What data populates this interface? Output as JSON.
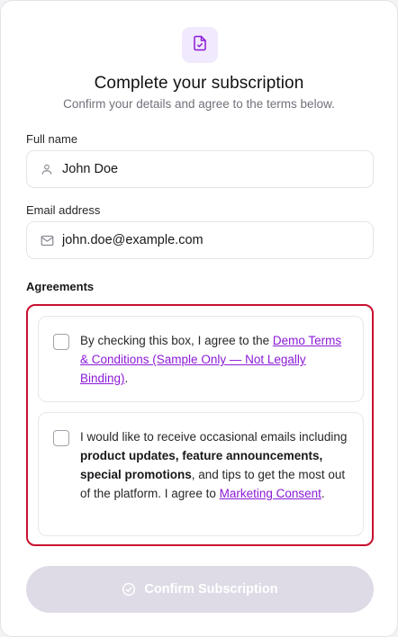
{
  "header": {
    "logo_icon": "file-check-icon",
    "title": "Complete your subscription",
    "subtitle": "Confirm your details and agree to the terms below."
  },
  "form": {
    "full_name": {
      "label": "Full name",
      "icon": "user-icon",
      "value": "John Doe"
    },
    "email": {
      "label": "Email address",
      "icon": "mail-icon",
      "value": "john.doe@example.com"
    }
  },
  "agreements": {
    "label": "Agreements",
    "terms": {
      "checked": false,
      "text_before": "By checking this box, I agree to the ",
      "link": "Demo Terms & Conditions (Sample Only — Not Legally Binding)",
      "text_after": "."
    },
    "marketing": {
      "checked": false,
      "text_before": "I would like to receive occasional emails including ",
      "bold": "product updates, feature announcements, special promotions",
      "text_middle": ", and tips to get the most out of the platform. I agree to ",
      "link": "Marketing Consent",
      "text_after": "."
    }
  },
  "confirm_button": {
    "icon": "check-circle-icon",
    "label": "Confirm Subscription",
    "disabled": true
  },
  "colors": {
    "accent": "#8b1bd6",
    "error_border": "#c8102e",
    "button_disabled": "#dedbe6"
  }
}
